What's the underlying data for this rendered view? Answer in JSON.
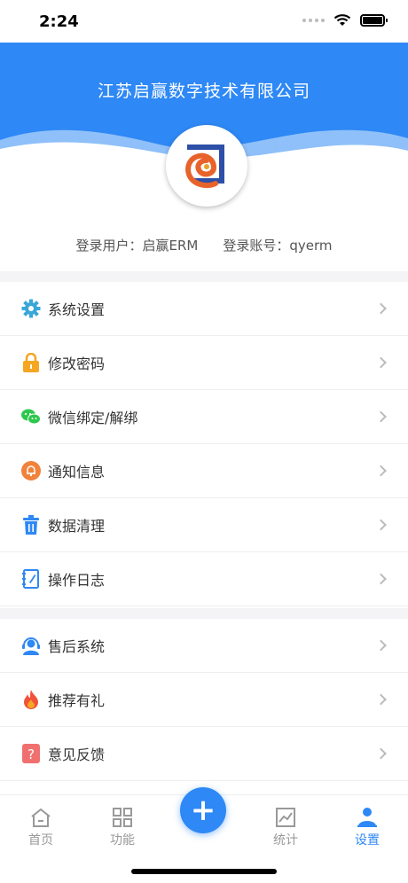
{
  "status_bar": {
    "time": "2:24"
  },
  "header": {
    "title": "江苏启赢数字技术有限公司"
  },
  "user": {
    "login_user_label": "登录用户：启赢ERM",
    "login_account_label": "登录账号：qyerm"
  },
  "menu_group_1": [
    {
      "label": "系统设置",
      "icon": "gear-icon",
      "color": "#3aa7d8"
    },
    {
      "label": "修改密码",
      "icon": "lock-icon",
      "color": "#f5a623"
    },
    {
      "label": "微信绑定/解绑",
      "icon": "wechat-icon",
      "color": "#2dc84d"
    },
    {
      "label": "通知信息",
      "icon": "bell-icon",
      "color": "#f0823a"
    },
    {
      "label": "数据清理",
      "icon": "trash-icon",
      "color": "#2e88f5"
    },
    {
      "label": "操作日志",
      "icon": "log-book-icon",
      "color": "#2e88f5"
    }
  ],
  "menu_group_2": [
    {
      "label": "售后系统",
      "icon": "headset-icon",
      "color": "#2e88f5"
    },
    {
      "label": "推荐有礼",
      "icon": "flame-icon",
      "color": "#f0523a"
    },
    {
      "label": "意见反馈",
      "icon": "feedback-icon",
      "color": "#f07070"
    }
  ],
  "tabs": [
    {
      "label": "首页",
      "icon": "home-icon"
    },
    {
      "label": "功能",
      "icon": "grid-icon"
    },
    {
      "label": "统计",
      "icon": "chart-icon"
    },
    {
      "label": "设置",
      "icon": "user-icon",
      "active": true
    }
  ],
  "fab": {
    "symbol": "+"
  },
  "colors": {
    "primary": "#2e88f5",
    "background_gap": "#f4f4f6"
  }
}
